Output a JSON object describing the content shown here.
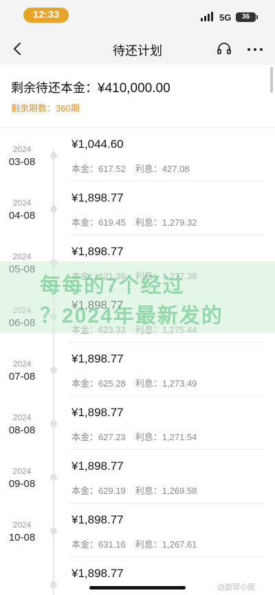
{
  "status_bar": {
    "time": "12:33",
    "network": "5G",
    "battery": "36"
  },
  "nav": {
    "title": "待还计划"
  },
  "summary": {
    "principal_label": "剩余待还本金：",
    "principal_amount": "¥410,000.00",
    "periods_label": "剩余期数：",
    "periods_value": "360期"
  },
  "schedule": [
    {
      "year": "2024",
      "date": "03-08",
      "amount": "¥1,044.60",
      "principal_label": "本金：",
      "principal": "617.52",
      "interest_label": "利息：",
      "interest": "427.08"
    },
    {
      "year": "2024",
      "date": "04-08",
      "amount": "¥1,898.77",
      "principal_label": "本金：",
      "principal": "619.45",
      "interest_label": "利息：",
      "interest": "1,279.32"
    },
    {
      "year": "2024",
      "date": "05-08",
      "amount": "¥1,898.77",
      "principal_label": "本金：",
      "principal": "621.39",
      "interest_label": "利息：",
      "interest": "1,277.38"
    },
    {
      "year": "2024",
      "date": "06-08",
      "amount": "¥1,898.77",
      "principal_label": "本金：",
      "principal": "623.33",
      "interest_label": "利息：",
      "interest": "1,275.44"
    },
    {
      "year": "2024",
      "date": "07-08",
      "amount": "¥1,898.77",
      "principal_label": "本金：",
      "principal": "625.28",
      "interest_label": "利息：",
      "interest": "1,273.49"
    },
    {
      "year": "2024",
      "date": "08-08",
      "amount": "¥1,898.77",
      "principal_label": "本金：",
      "principal": "627.23",
      "interest_label": "利息：",
      "interest": "1,271.54"
    },
    {
      "year": "2024",
      "date": "09-08",
      "amount": "¥1,898.77",
      "principal_label": "本金：",
      "principal": "629.19",
      "interest_label": "利息：",
      "interest": "1,269.58"
    },
    {
      "year": "2024",
      "date": "10-08",
      "amount": "¥1,898.77",
      "principal_label": "本金：",
      "principal": "631.16",
      "interest_label": "利息：",
      "interest": "1,267.61"
    },
    {
      "year": "",
      "date": "",
      "amount": "¥1,898.77",
      "principal_label": "",
      "principal": "",
      "interest_label": "",
      "interest": ""
    }
  ],
  "overlay": {
    "line1": "每每的7个经过",
    "line2": "？2024年最新发的"
  },
  "corner_watermark": "@鹿驿小居",
  "colors": {
    "accent_orange": "#e58a1f",
    "time_pill": "#e8a32b",
    "overlay_green": "#50be78"
  },
  "icons": {
    "back": "chevron-left-icon",
    "support": "headset-icon",
    "more": "more-dots-icon"
  }
}
